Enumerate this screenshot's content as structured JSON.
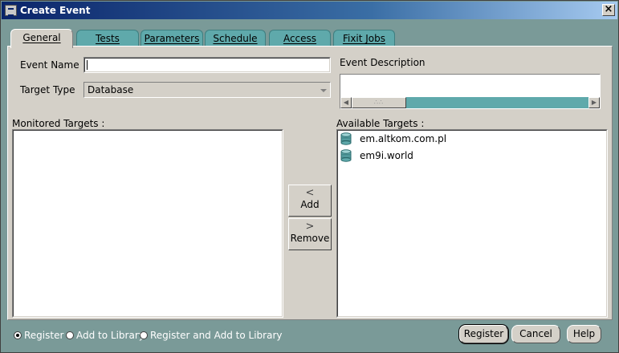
{
  "window": {
    "title": "Create Event",
    "close_glyph": "×"
  },
  "tabs": [
    {
      "label": "General",
      "active": true
    },
    {
      "label": "Tests",
      "active": false
    },
    {
      "label": "Parameters",
      "active": false
    },
    {
      "label": "Schedule",
      "active": false
    },
    {
      "label": "Access",
      "active": false
    },
    {
      "label": "Fixit Jobs",
      "active": false
    }
  ],
  "general": {
    "event_name_label": "Event Name",
    "event_name_value": "",
    "target_type_label": "Target Type",
    "target_type_value": "Database",
    "event_description_label": "Event Description",
    "event_description_value": "",
    "monitored_targets_label": "Monitored Targets :",
    "monitored_targets": [],
    "available_targets_label": "Available Targets :",
    "available_targets": [
      {
        "name": "em.altkom.com.pl",
        "icon": "database-icon"
      },
      {
        "name": "em9i.world",
        "icon": "database-icon"
      }
    ],
    "add_label": "Add",
    "add_icon": "chevron-left-icon",
    "remove_label": "Remove",
    "remove_icon": "chevron-right-icon"
  },
  "footer": {
    "radios": [
      {
        "label": "Register",
        "selected": true
      },
      {
        "label": "Add to Library",
        "selected": false
      },
      {
        "label": "Register and Add to Library",
        "selected": false
      }
    ],
    "register_label": "Register",
    "cancel_label": "Cancel",
    "help_label": "Help"
  },
  "colors": {
    "teal": "#5fa9ab",
    "frame": "#7a9a98",
    "title_blue": "#0a246a",
    "face": "#d4d0c8"
  }
}
